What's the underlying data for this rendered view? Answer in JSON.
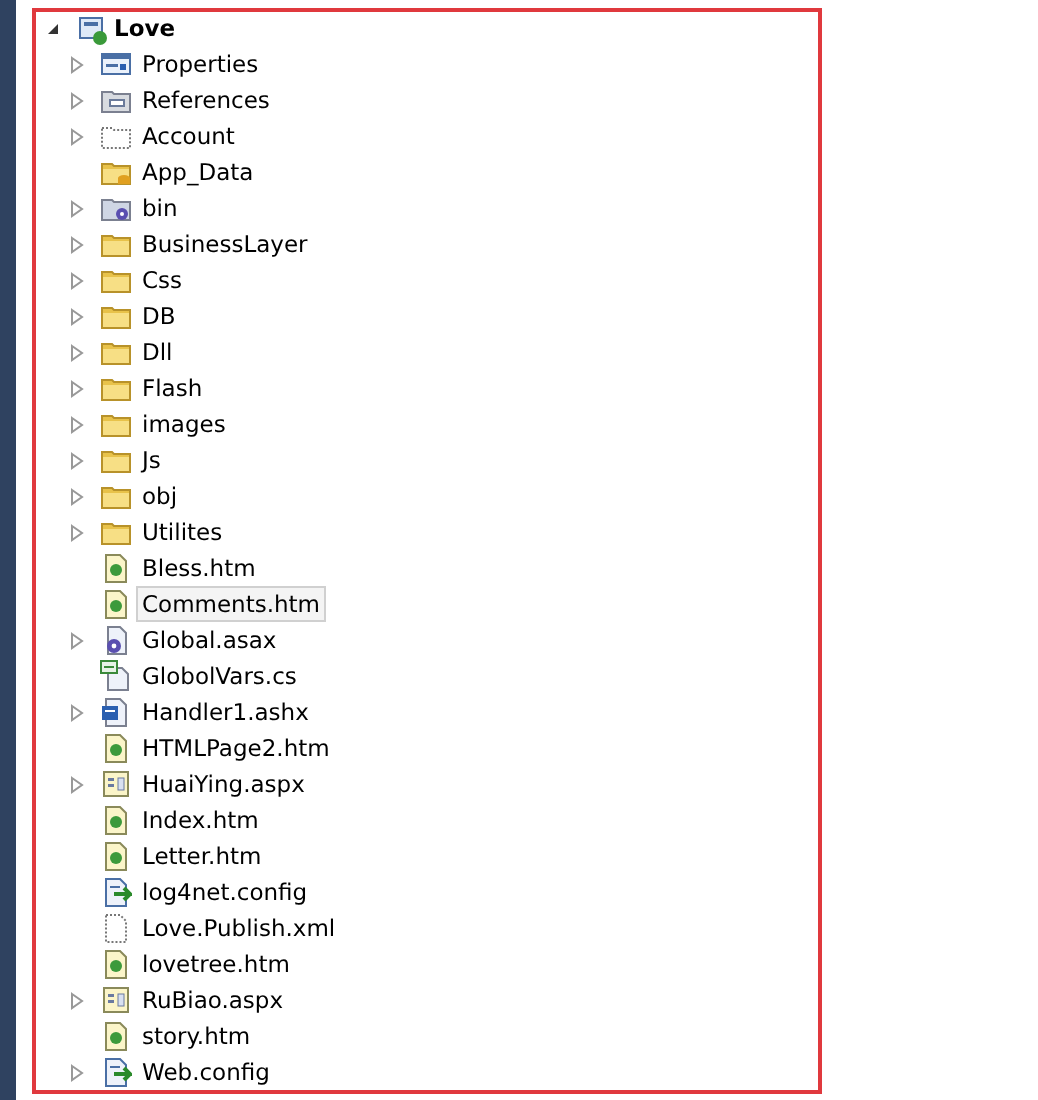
{
  "tree": {
    "root": {
      "label": "Love",
      "kind": "project",
      "expanded": true
    },
    "children": [
      {
        "label": "Properties",
        "kind": "properties",
        "expander": true,
        "selected": false
      },
      {
        "label": "References",
        "kind": "references",
        "expander": true,
        "selected": false
      },
      {
        "label": "Account",
        "kind": "dashed-folder",
        "expander": true,
        "selected": false
      },
      {
        "label": "App_Data",
        "kind": "data-folder",
        "expander": false,
        "selected": false
      },
      {
        "label": "bin",
        "kind": "gear-folder",
        "expander": true,
        "selected": false
      },
      {
        "label": "BusinessLayer",
        "kind": "folder",
        "expander": true,
        "selected": false
      },
      {
        "label": "Css",
        "kind": "folder",
        "expander": true,
        "selected": false
      },
      {
        "label": "DB",
        "kind": "folder",
        "expander": true,
        "selected": false
      },
      {
        "label": "Dll",
        "kind": "folder",
        "expander": true,
        "selected": false
      },
      {
        "label": "Flash",
        "kind": "folder",
        "expander": true,
        "selected": false
      },
      {
        "label": "images",
        "kind": "folder",
        "expander": true,
        "selected": false
      },
      {
        "label": "Js",
        "kind": "folder",
        "expander": true,
        "selected": false
      },
      {
        "label": "obj",
        "kind": "folder",
        "expander": true,
        "selected": false
      },
      {
        "label": "Utilites",
        "kind": "folder",
        "expander": true,
        "selected": false
      },
      {
        "label": "Bless.htm",
        "kind": "htm",
        "expander": false,
        "selected": false
      },
      {
        "label": "Comments.htm",
        "kind": "htm",
        "expander": false,
        "selected": true
      },
      {
        "label": "Global.asax",
        "kind": "asax",
        "expander": true,
        "selected": false
      },
      {
        "label": "GlobolVars.cs",
        "kind": "cs",
        "expander": false,
        "selected": false
      },
      {
        "label": "Handler1.ashx",
        "kind": "ashx",
        "expander": true,
        "selected": false
      },
      {
        "label": "HTMLPage2.htm",
        "kind": "htm",
        "expander": false,
        "selected": false
      },
      {
        "label": "HuaiYing.aspx",
        "kind": "aspx",
        "expander": true,
        "selected": false
      },
      {
        "label": "Index.htm",
        "kind": "htm",
        "expander": false,
        "selected": false
      },
      {
        "label": "Letter.htm",
        "kind": "htm",
        "expander": false,
        "selected": false
      },
      {
        "label": "log4net.config",
        "kind": "config",
        "expander": false,
        "selected": false
      },
      {
        "label": "Love.Publish.xml",
        "kind": "xml",
        "expander": false,
        "selected": false
      },
      {
        "label": "lovetree.htm",
        "kind": "htm",
        "expander": false,
        "selected": false
      },
      {
        "label": "RuBiao.aspx",
        "kind": "aspx",
        "expander": true,
        "selected": false
      },
      {
        "label": "story.htm",
        "kind": "htm",
        "expander": false,
        "selected": false
      },
      {
        "label": "Web.config",
        "kind": "config",
        "expander": true,
        "selected": false
      }
    ]
  }
}
